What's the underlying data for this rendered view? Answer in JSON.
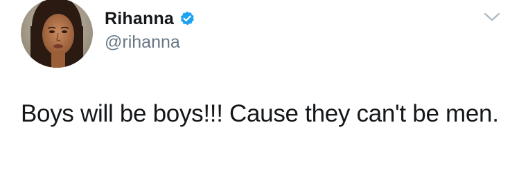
{
  "author": {
    "display_name": "Rihanna",
    "handle": "@rihanna",
    "verified": true
  },
  "tweet": {
    "text": "Boys will be boys!!! Cause they can't be men."
  },
  "icons": {
    "verified": "verified-badge-icon",
    "menu": "chevron-down-icon"
  },
  "colors": {
    "verified_blue": "#1da1f2",
    "handle_gray": "#657786",
    "text": "#14171a",
    "caret_gray": "#aab8c2"
  }
}
